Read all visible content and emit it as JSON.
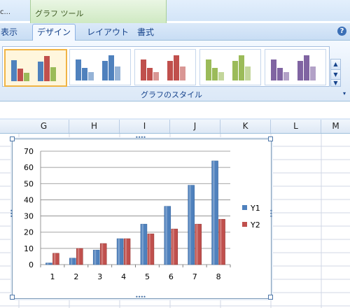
{
  "ribbon": {
    "truncated_left": "c...",
    "context_tab_label": "グラフ ツール",
    "tabs": [
      "表示",
      "デザイン",
      "レイアウト",
      "書式"
    ],
    "active_tab": "デザイン",
    "help_glyph": "?",
    "group_label": "グラフのスタイル",
    "scroll_up": "▲",
    "scroll_down": "▼",
    "scroll_more": "▼",
    "launcher": "▾"
  },
  "styles_gallery": [
    {
      "name": "style-1",
      "colors": [
        "#4f81bd",
        "#c0504d",
        "#9bbb59"
      ],
      "selected": true
    },
    {
      "name": "style-2",
      "colors": [
        "#4f81bd",
        "#4f81bd",
        "#95b3d7"
      ],
      "selected": false
    },
    {
      "name": "style-3",
      "colors": [
        "#c0504d",
        "#c0504d",
        "#d99694"
      ],
      "selected": false
    },
    {
      "name": "style-4",
      "colors": [
        "#9bbb59",
        "#9bbb59",
        "#c3d69b"
      ],
      "selected": false
    },
    {
      "name": "style-5",
      "colors": [
        "#8064a2",
        "#8064a2",
        "#b2a1c7"
      ],
      "selected": false
    }
  ],
  "columns": [
    "G",
    "H",
    "I",
    "J",
    "K",
    "L",
    "M"
  ],
  "chart_data": {
    "type": "bar",
    "categories": [
      "1",
      "2",
      "3",
      "4",
      "5",
      "6",
      "7",
      "8"
    ],
    "series": [
      {
        "name": "Y1",
        "color": "#4f81bd",
        "values": [
          1,
          4,
          9,
          16,
          25,
          36,
          49,
          64
        ]
      },
      {
        "name": "Y2",
        "color": "#c0504d",
        "values": [
          7,
          10,
          13,
          16,
          19,
          22,
          25,
          28
        ]
      }
    ],
    "yticks": [
      "0",
      "10",
      "20",
      "30",
      "40",
      "50",
      "60",
      "70"
    ],
    "ylim": [
      0,
      70
    ],
    "grid": true,
    "legend": "right"
  }
}
